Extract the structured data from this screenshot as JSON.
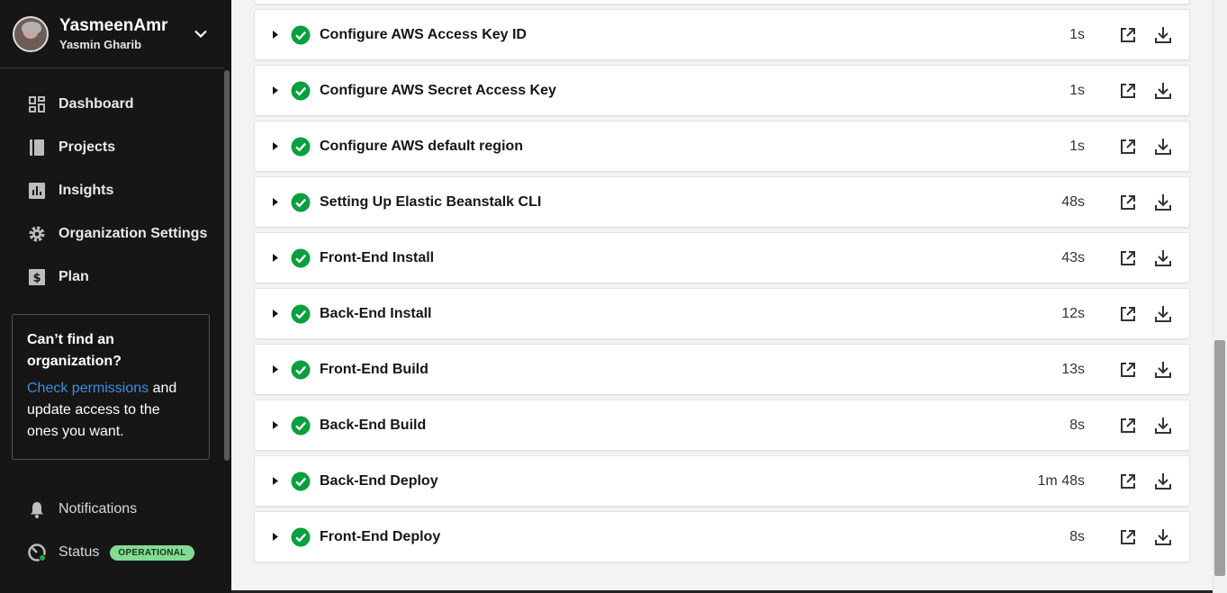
{
  "org": {
    "name": "YasmeenAmr",
    "user": "Yasmin Gharib"
  },
  "nav": {
    "items": [
      {
        "label": "Dashboard",
        "icon": "dashboard-icon"
      },
      {
        "label": "Projects",
        "icon": "projects-icon"
      },
      {
        "label": "Insights",
        "icon": "insights-icon"
      },
      {
        "label": "Organization Settings",
        "icon": "gear-icon"
      },
      {
        "label": "Plan",
        "icon": "dollar-icon"
      }
    ]
  },
  "help": {
    "title": "Can’t find an organization?",
    "link": "Check permissions",
    "text": " and update access to the ones you want."
  },
  "bottom": {
    "notifications": "Notifications",
    "status": "Status",
    "status_badge": "OPERATIONAL"
  },
  "steps": [
    {
      "name": "Configure AWS Access Key ID",
      "duration": "1s",
      "status": "success"
    },
    {
      "name": "Configure AWS Secret Access Key",
      "duration": "1s",
      "status": "success"
    },
    {
      "name": "Configure AWS default region",
      "duration": "1s",
      "status": "success"
    },
    {
      "name": "Setting Up Elastic Beanstalk CLI",
      "duration": "48s",
      "status": "success"
    },
    {
      "name": "Front-End Install",
      "duration": "43s",
      "status": "success"
    },
    {
      "name": "Back-End Install",
      "duration": "12s",
      "status": "success"
    },
    {
      "name": "Front-End Build",
      "duration": "13s",
      "status": "success"
    },
    {
      "name": "Back-End Build",
      "duration": "8s",
      "status": "success"
    },
    {
      "name": "Back-End Deploy",
      "duration": "1m 48s",
      "status": "success"
    },
    {
      "name": "Front-End Deploy",
      "duration": "8s",
      "status": "success"
    }
  ],
  "colors": {
    "sidebar_bg": "#161616",
    "success": "#0a9f3f",
    "link": "#3b8ee6",
    "badge": "#84d995"
  }
}
